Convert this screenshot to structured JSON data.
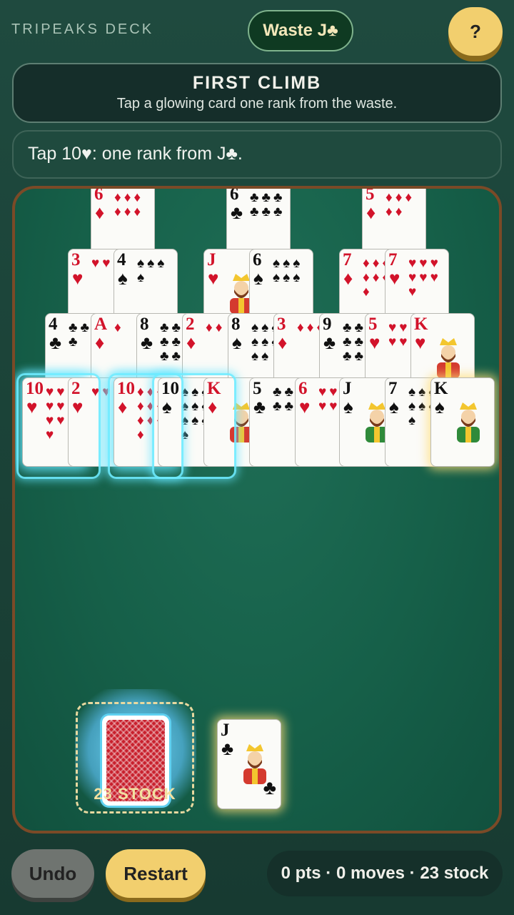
{
  "header": {
    "deck_label": "TRIPEAKS DECK",
    "waste_pill": "Waste J♣",
    "help_label": "?"
  },
  "title_panel": {
    "title": "FIRST CLIMB",
    "subtitle": "Tap a glowing card one rank from the waste."
  },
  "hint": "Tap 10♥: one rank from J♣.",
  "colors": {
    "red_suit": "#d2132a",
    "black_suit": "#111111",
    "felt": "#166049",
    "accent": "#f2cf6e"
  },
  "tableau": {
    "row1": [
      {
        "rank": "6",
        "suit": "♦",
        "color": "red",
        "pips": "♦♦♦♦♦♦"
      },
      {
        "rank": "6",
        "suit": "♣",
        "color": "black",
        "pips": "♣♣♣♣♣♣"
      },
      {
        "rank": "5",
        "suit": "♦",
        "color": "red",
        "pips": "♦♦♦♦♦"
      }
    ],
    "row2": [
      {
        "rank": "3",
        "suit": "♥",
        "color": "red",
        "pips": "♥♥♥"
      },
      {
        "rank": "4",
        "suit": "♠",
        "color": "black",
        "pips": "♠♠♠♠"
      },
      {
        "rank": "J",
        "suit": "♥",
        "color": "red",
        "pips": ""
      },
      {
        "rank": "6",
        "suit": "♠",
        "color": "black",
        "pips": "♠♠♠♠♠♠"
      },
      {
        "rank": "7",
        "suit": "♦",
        "color": "red",
        "pips": "♦♦♦♦♦♦♦"
      },
      {
        "rank": "7",
        "suit": "♥",
        "color": "red",
        "pips": "♥♥♥♥♥♥♥"
      }
    ],
    "row3": [
      {
        "rank": "4",
        "suit": "♣",
        "color": "black",
        "pips": "♣♣♣♣"
      },
      {
        "rank": "A",
        "suit": "♦",
        "color": "red",
        "pips": "♦"
      },
      {
        "rank": "8",
        "suit": "♣",
        "color": "black",
        "pips": "♣♣♣♣♣♣♣♣"
      },
      {
        "rank": "2",
        "suit": "♦",
        "color": "red",
        "pips": "♦♦"
      },
      {
        "rank": "8",
        "suit": "♠",
        "color": "black",
        "pips": "♠♠♠♠♠♠♠♠"
      },
      {
        "rank": "3",
        "suit": "♦",
        "color": "red",
        "pips": "♦♦♦"
      },
      {
        "rank": "9",
        "suit": "♣",
        "color": "black",
        "pips": "♣♣♣♣♣♣♣♣♣"
      },
      {
        "rank": "5",
        "suit": "♥",
        "color": "red",
        "pips": "♥♥♥♥♥"
      },
      {
        "rank": "K",
        "suit": "♥",
        "color": "red",
        "pips": ""
      }
    ],
    "row4": [
      {
        "rank": "10",
        "suit": "♥",
        "color": "red",
        "pips": "♥♥♥♥♥♥♥♥♥♥"
      },
      {
        "rank": "2",
        "suit": "♥",
        "color": "red",
        "pips": "♥♥"
      },
      {
        "rank": "10",
        "suit": "♦",
        "color": "red",
        "pips": "♦♦♦♦♦♦♦♦♦♦"
      },
      {
        "rank": "10",
        "suit": "♠",
        "color": "black",
        "pips": "♠♠♠♠♠♠♠♠♠♠"
      },
      {
        "rank": "K",
        "suit": "♦",
        "color": "red",
        "pips": ""
      },
      {
        "rank": "5",
        "suit": "♣",
        "color": "black",
        "pips": "♣♣♣♣♣"
      },
      {
        "rank": "6",
        "suit": "♥",
        "color": "red",
        "pips": "♥♥♥♥♥♥"
      },
      {
        "rank": "J",
        "suit": "♠",
        "color": "black",
        "pips": ""
      },
      {
        "rank": "7",
        "suit": "♠",
        "color": "black",
        "pips": "♠♠♠♠♠♠♠"
      },
      {
        "rank": "K",
        "suit": "♠",
        "color": "black",
        "pips": ""
      }
    ]
  },
  "stock": {
    "label": "23 STOCK"
  },
  "waste_card": {
    "rank": "J",
    "suit": "♣",
    "color": "black"
  },
  "footer": {
    "undo_label": "Undo",
    "restart_label": "Restart",
    "stats": "0 pts · 0 moves · 23 stock"
  }
}
